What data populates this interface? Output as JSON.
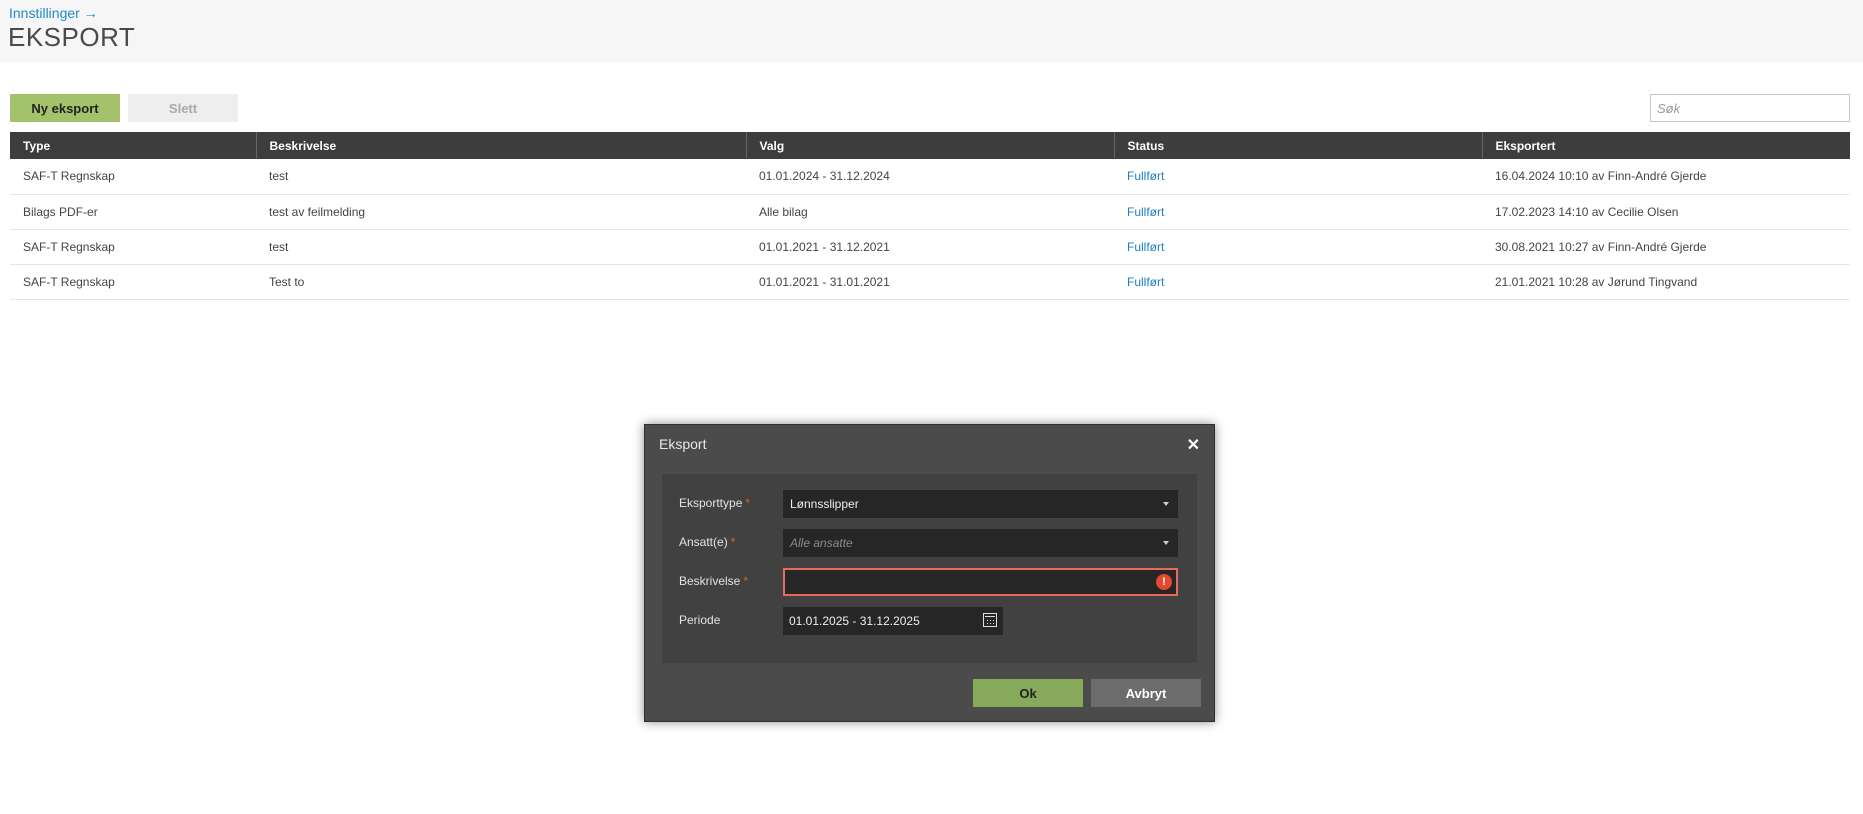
{
  "header": {
    "breadcrumb": "Innstillinger →",
    "title": "EKSPORT"
  },
  "toolbar": {
    "new_label": "Ny eksport",
    "delete_label": "Slett",
    "search_placeholder": "Søk"
  },
  "table": {
    "columns": [
      "Type",
      "Beskrivelse",
      "Valg",
      "Status",
      "Eksportert"
    ],
    "rows": [
      [
        "SAF-T Regnskap",
        "test",
        "01.01.2024 - 31.12.2024",
        "Fullført",
        "16.04.2024 10:10 av Finn-André Gjerde"
      ],
      [
        "Bilags PDF-er",
        "test av feilmelding",
        "Alle bilag",
        "Fullført",
        "17.02.2023 14:10 av Cecilie Olsen"
      ],
      [
        "SAF-T Regnskap",
        "test",
        "01.01.2021 - 31.12.2021",
        "Fullført",
        "30.08.2021 10:27 av Finn-André Gjerde"
      ],
      [
        "SAF-T Regnskap",
        "Test to",
        "01.01.2021 - 31.01.2021",
        "Fullført",
        "21.01.2021 10:28 av Jørund Tingvand"
      ]
    ]
  },
  "modal": {
    "title": "Eksport",
    "close": "✕",
    "required_mark": "*",
    "fields": {
      "export_type": {
        "label": "Eksporttype",
        "value": "Lønnsslipper"
      },
      "employees": {
        "label": "Ansatt(e)",
        "placeholder": "Alle ansatte"
      },
      "description": {
        "label": "Beskrivelse",
        "value": ""
      },
      "period": {
        "label": "Periode",
        "value": "01.01.2025 - 31.12.2025"
      }
    },
    "error_glyph": "!",
    "ok_label": "Ok",
    "cancel_label": "Avbryt"
  },
  "colors": {
    "accent_green": "#a4c26b",
    "link_blue": "#1f7ec0",
    "table_header": "#3d3d3d",
    "modal_bg": "#4b4b4b",
    "error_red": "#e2492f"
  },
  "icons": [
    "arrow-right-icon",
    "close-icon",
    "chevron-down-icon",
    "error-icon",
    "calendar-icon"
  ]
}
